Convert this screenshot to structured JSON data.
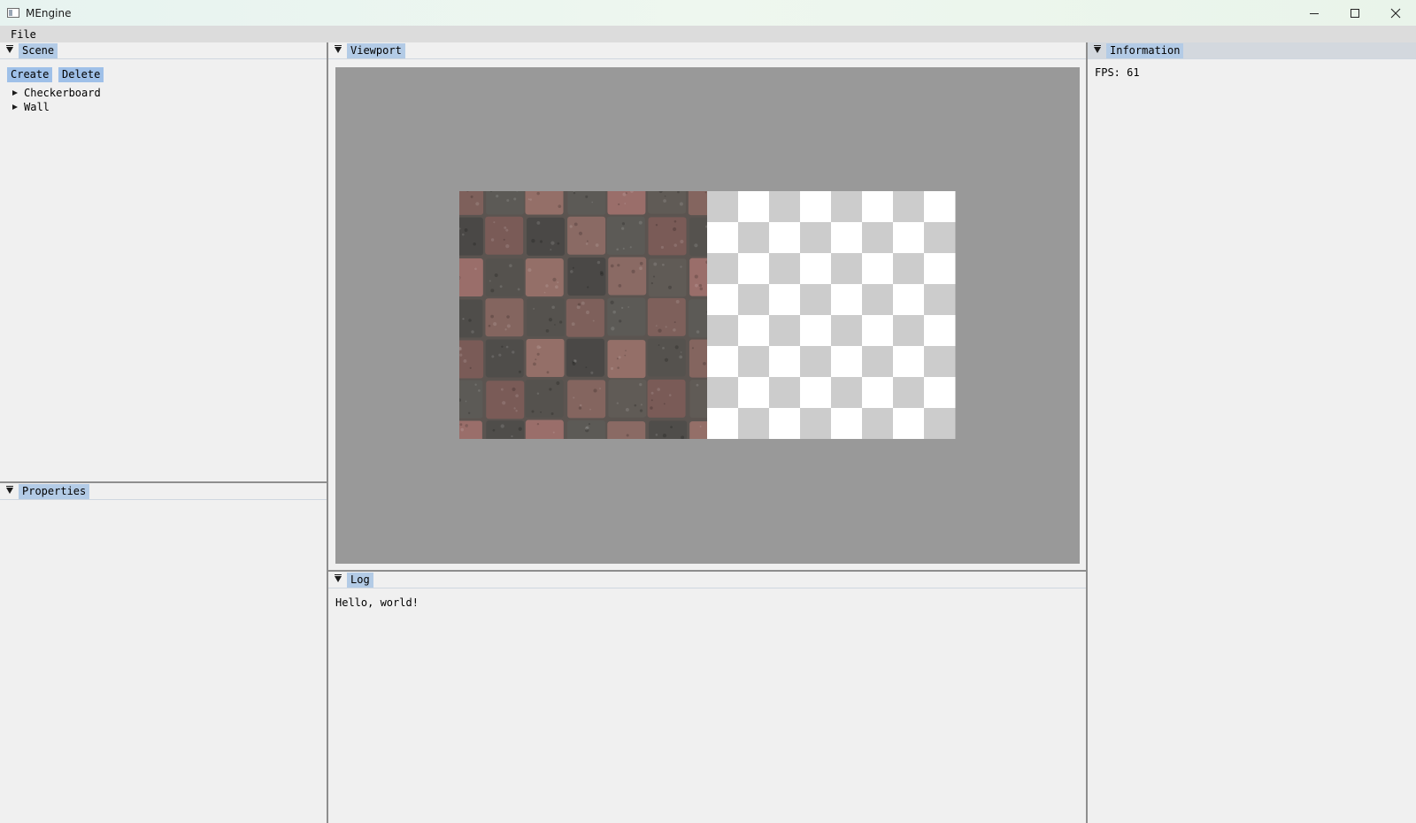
{
  "window": {
    "title": "MEngine"
  },
  "menu": {
    "file_label": "File"
  },
  "scene_panel": {
    "tab_label": "Scene",
    "create_label": "Create",
    "delete_label": "Delete",
    "items": [
      {
        "label": "Checkerboard"
      },
      {
        "label": "Wall"
      }
    ]
  },
  "properties_panel": {
    "tab_label": "Properties"
  },
  "viewport_panel": {
    "tab_label": "Viewport",
    "background_color": "#999999",
    "checker_colors": [
      "#cccccc",
      "#ffffff"
    ]
  },
  "log_panel": {
    "tab_label": "Log",
    "lines": [
      "Hello, world!"
    ]
  },
  "info_panel": {
    "tab_label": "Information",
    "fps_text": "FPS: 61"
  },
  "colors": {
    "tab_active": "#b3cbe6",
    "button": "#9fc0e8",
    "separator": "#8e8e8e"
  }
}
